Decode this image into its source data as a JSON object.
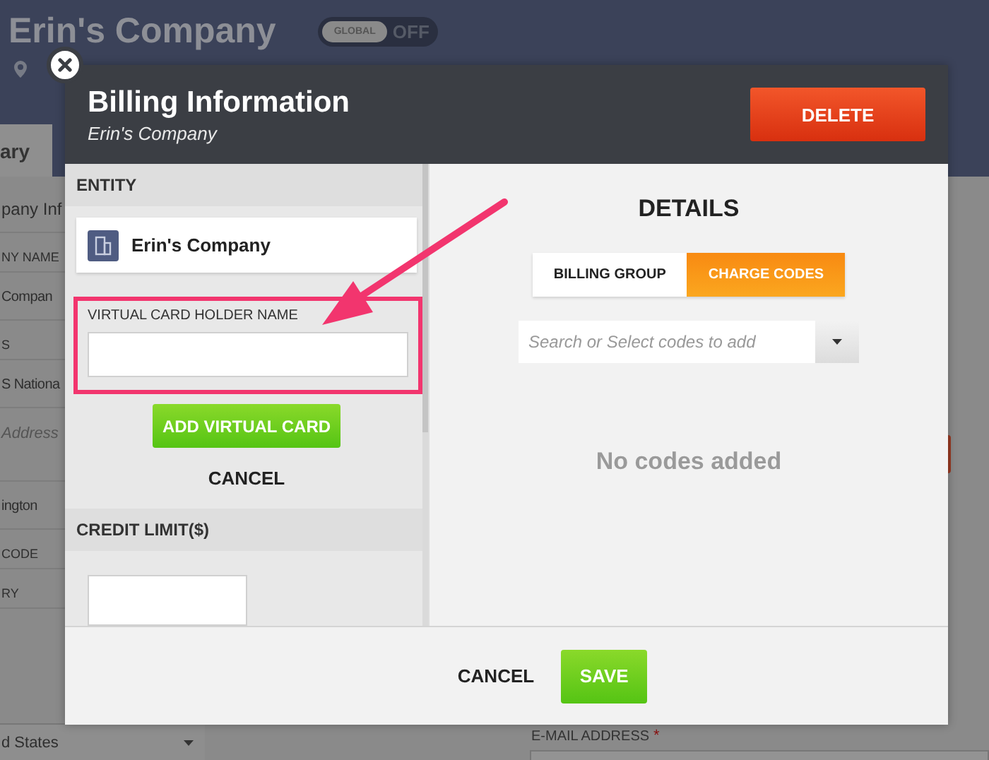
{
  "background_page": {
    "title": "Erin's Company",
    "global_toggle": {
      "label": "GLOBAL",
      "state": "OFF",
      "on": false
    },
    "tab": "ary",
    "left_items": [
      {
        "kind": "heading",
        "text": "pany Inf"
      },
      {
        "kind": "label",
        "text": "NY NAME"
      },
      {
        "kind": "value",
        "text": "Compan"
      },
      {
        "kind": "label",
        "text": "S"
      },
      {
        "kind": "value",
        "text": "S Nationa"
      },
      {
        "kind": "placeholder",
        "text": "Address"
      },
      {
        "kind": "value",
        "text": "ington"
      },
      {
        "kind": "label",
        "text": "CODE"
      },
      {
        "kind": "label",
        "text": "RY"
      },
      {
        "kind": "select",
        "text": "d States"
      }
    ],
    "email_field": {
      "label": "E-MAIL ADDRESS",
      "required_mark": "*"
    }
  },
  "modal": {
    "title": "Billing Information",
    "subtitle": "Erin's Company",
    "delete_button": "DELETE",
    "entity": {
      "heading": "ENTITY",
      "name": "Erin's Company"
    },
    "virtual_card": {
      "label": "VIRTUAL CARD HOLDER NAME",
      "highlighted": true,
      "add_button": "ADD VIRTUAL CARD",
      "cancel_button": "CANCEL"
    },
    "credit_limit": {
      "heading": "CREDIT LIMIT($)"
    },
    "details": {
      "heading": "DETAILS",
      "tabs": [
        {
          "label": "BILLING GROUP",
          "selected": false
        },
        {
          "label": "CHARGE CODES",
          "selected": true
        }
      ],
      "code_select": {
        "placeholder": "Search or Select codes to add"
      },
      "empty_message": "No codes added"
    },
    "footer": {
      "cancel_button": "CANCEL",
      "save_button": "SAVE"
    }
  }
}
